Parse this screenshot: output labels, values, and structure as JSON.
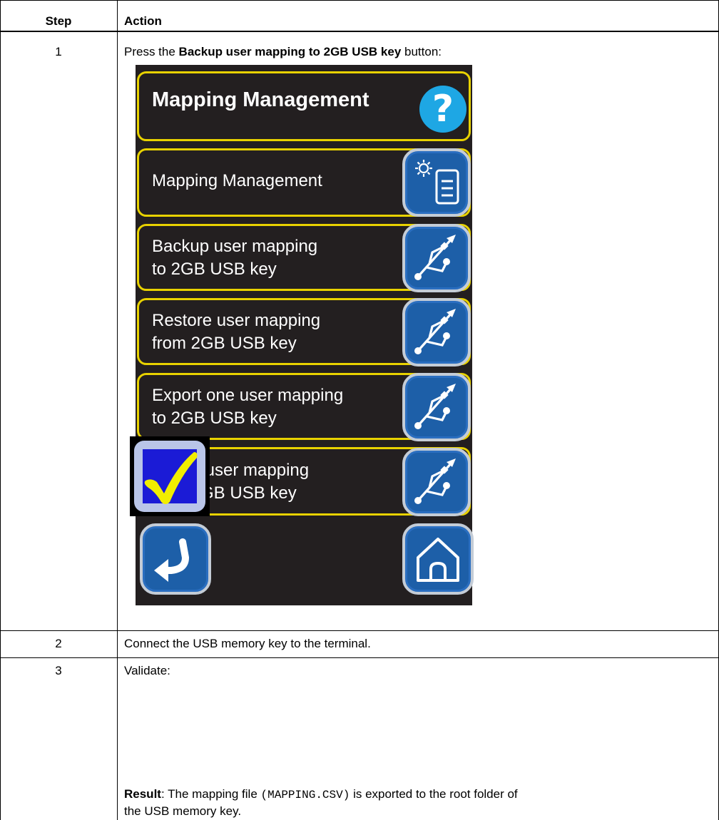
{
  "table": {
    "headers": {
      "step": "Step",
      "action": "Action"
    },
    "rows": [
      {
        "step": "1",
        "text_before": "Press the ",
        "text_bold": "Backup user mapping to 2GB USB key",
        "text_after": " button:"
      },
      {
        "step": "2",
        "text": "Connect the USB memory key to the terminal."
      },
      {
        "step": "3",
        "text": "Validate:",
        "result_label": "Result",
        "result_text_1": ": The mapping file ",
        "result_file": "(MAPPING.CSV)",
        "result_text_2": " is exported to the root folder of",
        "result_text_3": "the USB memory key."
      }
    ]
  },
  "screen": {
    "title": "Mapping Management",
    "help_icon": "question-mark-icon",
    "menu_items": [
      {
        "line1": "Mapping Management",
        "line2": "",
        "icon": "settings-document-icon"
      },
      {
        "line1": "Backup user mapping",
        "line2": "to 2GB USB key",
        "icon": "usb-icon"
      },
      {
        "line1": "Restore user mapping",
        "line2": "from 2GB USB key",
        "icon": "usb-icon"
      },
      {
        "line1": "Export one user mapping",
        "line2": "to 2GB USB key",
        "icon": "usb-icon"
      },
      {
        "line1": "Import user mapping",
        "line2": "from 2GB USB key",
        "icon": "usb-icon"
      }
    ],
    "back_icon": "return-arrow-icon",
    "home_icon": "home-icon"
  },
  "validate_icon": "checkmark-icon",
  "colors": {
    "screen_bg": "#231f20",
    "panel_border": "#e8d200",
    "button_blue": "#1d5fa8",
    "help_blue": "#1ea7e4",
    "check_yellow": "#f2ee00",
    "check_box_blue": "#1b1bd6"
  }
}
